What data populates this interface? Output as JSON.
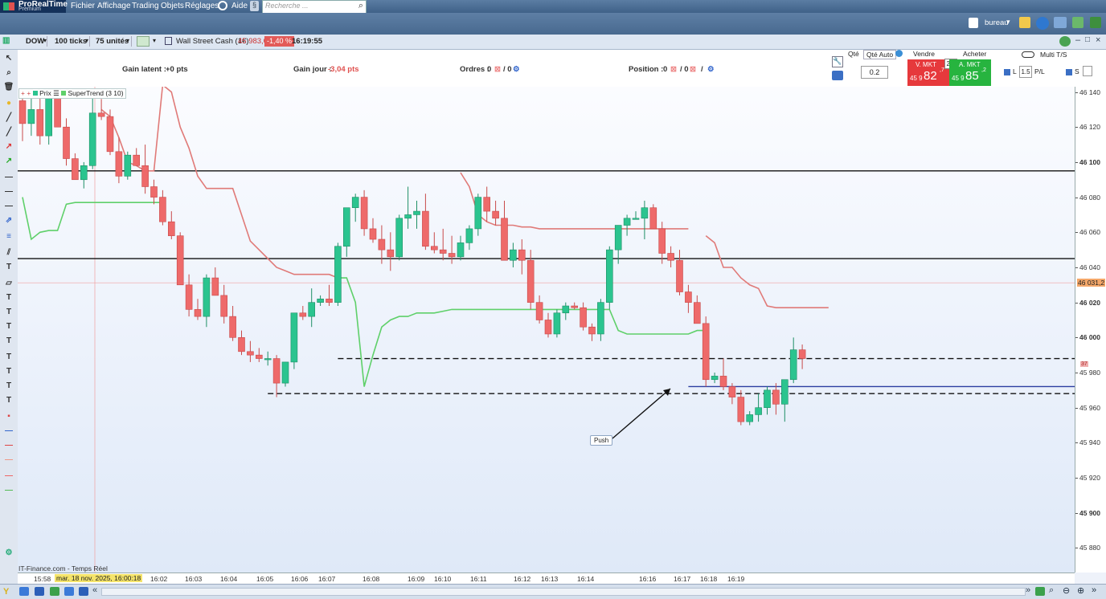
{
  "app": {
    "title_line1": "ProRealTime",
    "title_line2": "Premium"
  },
  "menu": {
    "items": [
      "Fichier",
      "Affichage",
      "Trading",
      "Objets",
      "Réglages",
      "Aide"
    ],
    "search_placeholder": "Recherche ..."
  },
  "workspace": {
    "label": "bureau"
  },
  "toolbar": {
    "symbol": "DOW",
    "ticks": "100 ticks",
    "units": "75 unités",
    "instrument": "Wall Street Cash (1€)",
    "price": "45 983,0",
    "change": "-1,40 %",
    "time": "16:19:55"
  },
  "infobar": {
    "gain_latent_label": "Gain latent :",
    "gain_latent_value": "+0 pts",
    "gain_jour_label": "Gain jour :",
    "gain_jour_value": "-3,04 pts",
    "ordres_label": "Ordres :",
    "ordres_value": "0",
    "ordres_sep": "/ 0",
    "position_label": "Position :",
    "position_value": "0",
    "position_sep1": "/ 0",
    "position_sep2": "/"
  },
  "order_panel": {
    "qte_label": "Qté",
    "qte_auto": "Qté Auto",
    "qty_value": "0.2",
    "sell_label": "Vendre",
    "buy_label": "Acheter",
    "sell_mode": "V. MKT",
    "buy_mode": "A. MKT",
    "spread": "2,5",
    "sell_prefix": "45 9",
    "sell_big": "82",
    "sell_sup": ",7",
    "buy_prefix": "45 9",
    "buy_big": "85",
    "buy_sup": ",2",
    "multi_ts": "Multi T/S",
    "l_label": "L",
    "l_value": "1.5",
    "pl_label": "P/L",
    "s_label": "S"
  },
  "chart": {
    "legend_price": "Prix",
    "legend_indicator": "SuperTrend (3 10)",
    "source": "IT-Finance.com - Temps Réel",
    "annotation": "Push",
    "price_tag": "46 031,2",
    "countdown": "37",
    "colors": {
      "up": "#2bc48f",
      "down": "#ee6a6a",
      "supertrend_down": "#e07a78",
      "supertrend_up": "#5fd06a",
      "hline": "#111111",
      "order_line": "#2b3da0"
    }
  },
  "xaxis": {
    "date_label": "mar. 18 nov. 2025, 16:00:18",
    "labels": [
      "15:58",
      "16:02",
      "16:03",
      "16:04",
      "16:05",
      "16:06",
      "16:07",
      "16:08",
      "16:09",
      "16:10",
      "16:11",
      "16:12",
      "16:13",
      "16:14",
      "16:16",
      "16:17",
      "16:18",
      "16:19"
    ]
  },
  "yaxis": {
    "labels": [
      "46 140",
      "46 120",
      "46 100",
      "46 080",
      "46 060",
      "46 040",
      "46 020",
      "46 000",
      "45 980",
      "45 960",
      "45 940",
      "45 920",
      "45 900",
      "45 880"
    ]
  },
  "chart_data": {
    "type": "candlestick",
    "y_unit": "points",
    "ylim": [
      45866,
      46143
    ],
    "candles": [
      [
        46135,
        46140,
        46112,
        46122
      ],
      [
        46122,
        46140,
        46115,
        46130
      ],
      [
        46130,
        46140,
        46110,
        46115
      ],
      [
        46115,
        46142,
        46110,
        46138
      ],
      [
        46138,
        46140,
        46128,
        46120
      ],
      [
        46120,
        46125,
        46098,
        46102
      ],
      [
        46102,
        46105,
        46090,
        46090
      ],
      [
        46090,
        46100,
        46085,
        46098
      ],
      [
        46098,
        46142,
        46096,
        46128
      ],
      [
        46128,
        46136,
        46124,
        46126
      ],
      [
        46126,
        46130,
        46104,
        46106
      ],
      [
        46106,
        46114,
        46088,
        46092
      ],
      [
        46092,
        46106,
        46090,
        46104
      ],
      [
        46104,
        46108,
        46098,
        46098
      ],
      [
        46098,
        46110,
        46082,
        46086
      ],
      [
        46086,
        46090,
        46076,
        46080
      ],
      [
        46080,
        46084,
        46064,
        46066
      ],
      [
        46066,
        46072,
        46056,
        46058
      ],
      [
        46058,
        46060,
        46034,
        46030
      ],
      [
        46030,
        46036,
        46012,
        46016
      ],
      [
        46016,
        46022,
        46010,
        46012
      ],
      [
        46012,
        46036,
        46006,
        46034
      ],
      [
        46034,
        46040,
        46024,
        46024
      ],
      [
        46024,
        46030,
        46008,
        46012
      ],
      [
        46012,
        46018,
        45998,
        46000
      ],
      [
        46000,
        46004,
        45990,
        45992
      ],
      [
        45992,
        45998,
        45986,
        45990
      ],
      [
        45990,
        45994,
        45986,
        45988
      ],
      [
        45988,
        45992,
        45984,
        45988
      ],
      [
        45988,
        45990,
        45966,
        45974
      ],
      [
        45974,
        45986,
        45972,
        45986
      ],
      [
        45986,
        46014,
        45982,
        46014
      ],
      [
        46014,
        46018,
        46010,
        46012
      ],
      [
        46012,
        46028,
        46006,
        46020
      ],
      [
        46020,
        46024,
        46018,
        46022
      ],
      [
        46022,
        46030,
        46018,
        46020
      ],
      [
        46020,
        46054,
        46018,
        46052
      ],
      [
        46052,
        46074,
        46046,
        46074
      ],
      [
        46074,
        46082,
        46066,
        46080
      ],
      [
        46080,
        46084,
        46058,
        46062
      ],
      [
        46062,
        46068,
        46054,
        46056
      ],
      [
        46056,
        46064,
        46042,
        46050
      ],
      [
        46050,
        46060,
        46038,
        46046
      ],
      [
        46046,
        46070,
        46044,
        46068
      ],
      [
        46068,
        46086,
        46062,
        46070
      ],
      [
        46070,
        46078,
        46062,
        46072
      ],
      [
        46072,
        46082,
        46050,
        46052
      ],
      [
        46052,
        46060,
        46048,
        46050
      ],
      [
        46050,
        46062,
        46044,
        46048
      ],
      [
        46048,
        46058,
        46042,
        46046
      ],
      [
        46046,
        46058,
        46044,
        46054
      ],
      [
        46054,
        46064,
        46050,
        46062
      ],
      [
        46062,
        46082,
        46058,
        46080
      ],
      [
        46080,
        46086,
        46066,
        46072
      ],
      [
        46072,
        46078,
        46064,
        46068
      ],
      [
        46068,
        46078,
        46044,
        46044
      ],
      [
        46044,
        46054,
        46040,
        46050
      ],
      [
        46050,
        46056,
        46036,
        46044
      ],
      [
        46044,
        46050,
        46016,
        46020
      ],
      [
        46020,
        46024,
        46008,
        46010
      ],
      [
        46010,
        46014,
        46000,
        46002
      ],
      [
        46002,
        46016,
        46000,
        46014
      ],
      [
        46014,
        46020,
        46010,
        46018
      ],
      [
        46018,
        46020,
        46016,
        46017
      ],
      [
        46017,
        46020,
        46004,
        46006
      ],
      [
        46006,
        46008,
        45998,
        46002
      ],
      [
        46002,
        46022,
        45998,
        46020
      ],
      [
        46020,
        46052,
        46016,
        46050
      ],
      [
        46050,
        46064,
        46042,
        46064
      ],
      [
        46064,
        46070,
        46058,
        46068
      ],
      [
        46068,
        46072,
        46068,
        46068
      ],
      [
        46068,
        46078,
        46056,
        46074
      ],
      [
        46074,
        46076,
        46062,
        46062
      ],
      [
        46062,
        46066,
        46042,
        46048
      ],
      [
        46048,
        46052,
        46040,
        46044
      ],
      [
        46044,
        46050,
        46024,
        46026
      ],
      [
        46026,
        46030,
        46014,
        46020
      ],
      [
        46020,
        46024,
        46012,
        46008
      ],
      [
        46008,
        46012,
        45972,
        45976
      ],
      [
        45976,
        45980,
        45974,
        45978
      ],
      [
        45978,
        45988,
        45970,
        45972
      ],
      [
        45972,
        45974,
        45962,
        45966
      ],
      [
        45966,
        45970,
        45950,
        45952
      ],
      [
        45952,
        45958,
        45950,
        45956
      ],
      [
        45956,
        45968,
        45952,
        45960
      ],
      [
        45960,
        45972,
        45956,
        45970
      ],
      [
        45970,
        45974,
        45956,
        45962
      ],
      [
        45962,
        45976,
        45952,
        45976
      ],
      [
        45976,
        46000,
        45974,
        45993
      ],
      [
        45993,
        45996,
        45982,
        45988
      ]
    ],
    "supertrend": {
      "down": [
        [
          9,
          46130
        ],
        [
          10,
          46126
        ],
        [
          11,
          46114
        ],
        [
          12,
          46100
        ],
        [
          13,
          46098
        ],
        [
          14,
          46095
        ],
        [
          15,
          46095
        ],
        [
          16,
          46144
        ],
        [
          17,
          46140
        ],
        [
          18,
          46120
        ],
        [
          19,
          46108
        ],
        [
          20,
          46092
        ],
        [
          21,
          46085
        ],
        [
          22,
          46085
        ],
        [
          23,
          46085
        ],
        [
          24,
          46085
        ],
        [
          25,
          46070
        ],
        [
          26,
          46055
        ],
        [
          27,
          46050
        ],
        [
          28,
          46045
        ],
        [
          29,
          46040
        ],
        [
          30,
          46038
        ],
        [
          31,
          46036
        ],
        [
          32,
          46036
        ],
        [
          33,
          46036
        ],
        [
          34,
          46036
        ],
        [
          35,
          46036
        ],
        [
          36,
          46034
        ],
        [
          50,
          46094
        ],
        [
          51,
          46086
        ],
        [
          52,
          46070
        ],
        [
          53,
          46066
        ],
        [
          54,
          46064
        ],
        [
          55,
          46064
        ],
        [
          56,
          46064
        ],
        [
          57,
          46063
        ],
        [
          58,
          46063
        ],
        [
          59,
          46062
        ],
        [
          60,
          46062
        ],
        [
          61,
          46062
        ],
        [
          62,
          46062
        ],
        [
          63,
          46062
        ],
        [
          64,
          46062
        ],
        [
          65,
          46062
        ],
        [
          66,
          46062
        ],
        [
          67,
          46062
        ],
        [
          68,
          46062
        ],
        [
          69,
          46062
        ],
        [
          70,
          46062
        ],
        [
          71,
          46062
        ],
        [
          72,
          46062
        ],
        [
          73,
          46062
        ],
        [
          74,
          46062
        ],
        [
          75,
          46062
        ],
        [
          76,
          46062
        ],
        [
          78,
          46058
        ],
        [
          79,
          46054
        ],
        [
          80,
          46040
        ],
        [
          81,
          46040
        ],
        [
          82,
          46034
        ],
        [
          83,
          46030
        ],
        [
          84,
          46028
        ],
        [
          85,
          46018
        ],
        [
          86,
          46017
        ],
        [
          87,
          46017
        ],
        [
          88,
          46017
        ],
        [
          89,
          46017
        ],
        [
          90,
          46017
        ],
        [
          91,
          46017
        ],
        [
          92,
          46017
        ]
      ],
      "up": [
        [
          0,
          46080
        ],
        [
          1,
          46056
        ],
        [
          2,
          46060
        ],
        [
          3,
          46061
        ],
        [
          4,
          46061
        ],
        [
          5,
          46076
        ],
        [
          6,
          46077
        ],
        [
          7,
          46077
        ],
        [
          8,
          46077
        ],
        [
          9,
          46077
        ],
        [
          10,
          46077
        ],
        [
          11,
          46077
        ],
        [
          12,
          46077
        ],
        [
          13,
          46077
        ],
        [
          14,
          46077
        ],
        [
          15,
          46077
        ],
        [
          16,
          46077
        ],
        [
          36,
          46034
        ],
        [
          37,
          46034
        ],
        [
          38,
          46020
        ],
        [
          39,
          45972
        ],
        [
          40,
          45990
        ],
        [
          41,
          46006
        ],
        [
          42,
          46010
        ],
        [
          43,
          46012
        ],
        [
          44,
          46012
        ],
        [
          45,
          46014
        ],
        [
          46,
          46014
        ],
        [
          47,
          46014
        ],
        [
          48,
          46015
        ],
        [
          49,
          46016
        ],
        [
          50,
          46016
        ],
        [
          51,
          46016
        ],
        [
          52,
          46016
        ],
        [
          53,
          46016
        ],
        [
          54,
          46016
        ],
        [
          55,
          46016
        ],
        [
          56,
          46016
        ],
        [
          57,
          46016
        ],
        [
          58,
          46016
        ],
        [
          59,
          46016
        ],
        [
          60,
          46016
        ],
        [
          61,
          46016
        ],
        [
          62,
          46016
        ],
        [
          63,
          46016
        ],
        [
          64,
          46016
        ],
        [
          65,
          46016
        ],
        [
          66,
          46016
        ],
        [
          67,
          46016
        ],
        [
          68,
          46004
        ],
        [
          69,
          46002
        ],
        [
          70,
          46002
        ],
        [
          71,
          46002
        ],
        [
          72,
          46002
        ],
        [
          73,
          46002
        ],
        [
          74,
          46002
        ],
        [
          75,
          46002
        ],
        [
          76,
          46002
        ],
        [
          77,
          46004
        ],
        [
          78,
          46004
        ]
      ]
    },
    "hlines": [
      {
        "y": 46095,
        "style": "solid"
      },
      {
        "y": 46045,
        "style": "solid"
      },
      {
        "y": 45988,
        "style": "dashed",
        "from": 36
      },
      {
        "y": 45968,
        "style": "dashed",
        "from": 28
      },
      {
        "y": 45972,
        "style": "solid-blue",
        "from": 76
      }
    ],
    "current_price": 46031.2
  }
}
